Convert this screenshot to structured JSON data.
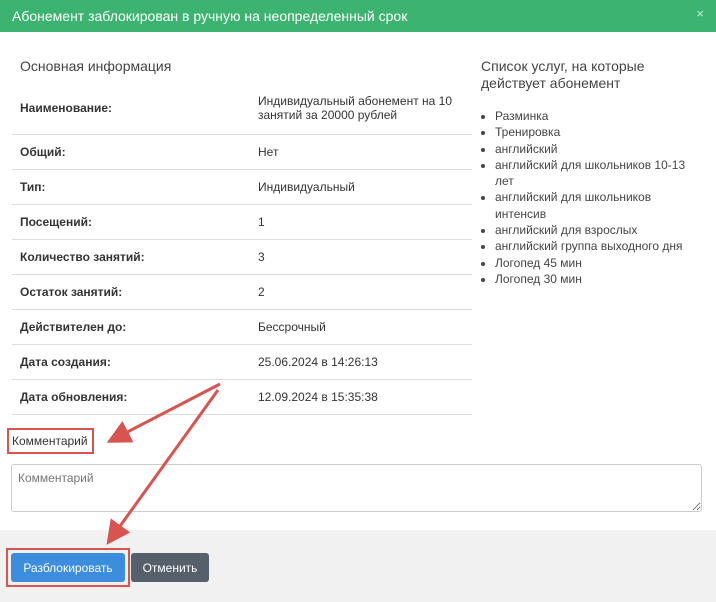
{
  "header": {
    "title": "Абонемент заблокирован в ручную на неопределенный срок",
    "close": "×"
  },
  "info": {
    "title": "Основная информация",
    "rows": [
      {
        "label": "Наименование:",
        "value": "Индивидуальный абонемент на 10 занятий за 20000 рублей"
      },
      {
        "label": "Общий:",
        "value": "Нет"
      },
      {
        "label": "Тип:",
        "value": "Индивидуальный"
      },
      {
        "label": "Посещений:",
        "value": "1"
      },
      {
        "label": "Количество занятий:",
        "value": "3"
      },
      {
        "label": "Остаток занятий:",
        "value": "2"
      },
      {
        "label": "Действителен до:",
        "value": "Бессрочный"
      },
      {
        "label": "Дата создания:",
        "value": "25.06.2024 в 14:26:13"
      },
      {
        "label": "Дата обновления:",
        "value": "12.09.2024 в 15:35:38"
      }
    ]
  },
  "services": {
    "title": "Список услуг, на которые действует абонемент",
    "items": [
      "Разминка",
      "Тренировка",
      "английский",
      "английский для школьников 10-13 лет",
      "английский для школьников интенсив",
      "английский для взрослых",
      "английский группа выходного дня",
      "Логопед 45 мин",
      "Логопед 30 мин"
    ]
  },
  "comment": {
    "label": "Комментарий",
    "placeholder": "Комментарий",
    "value": ""
  },
  "buttons": {
    "unlock": "Разблокировать",
    "cancel": "Отменить"
  },
  "colors": {
    "header": "#3cb371",
    "primary": "#3c8dde",
    "secondary": "#55606b",
    "annotation": "#d9534f"
  }
}
